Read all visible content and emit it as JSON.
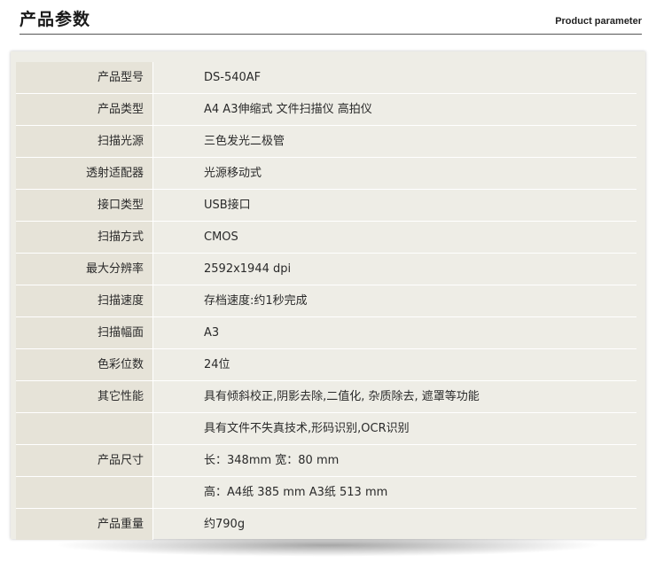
{
  "header": {
    "title": "产品参数",
    "subtitle": "Product parameter"
  },
  "specs": [
    {
      "label": "产品型号",
      "value": "DS-540AF"
    },
    {
      "label": "产品类型",
      "value": "A4 A3伸缩式 文件扫描仪 高拍仪"
    },
    {
      "label": "扫描光源",
      "value": "三色发光二极管"
    },
    {
      "label": "透射适配器",
      "value": "光源移动式"
    },
    {
      "label": "接口类型",
      "value": "USB接口"
    },
    {
      "label": "扫描方式",
      "value": "CMOS"
    },
    {
      "label": "最大分辨率",
      "value": "2592x1944 dpi"
    },
    {
      "label": "扫描速度",
      "value": "存档速度:约1秒完成"
    },
    {
      "label": "扫描幅面",
      "value": "A3"
    },
    {
      "label": "色彩位数",
      "value": "24位"
    },
    {
      "label": "其它性能",
      "value": "具有倾斜校正,阴影去除,二值化, 杂质除去, 遮罩等功能"
    },
    {
      "label": "",
      "value": "具有文件不失真技术,形码识别,OCR识别"
    },
    {
      "label": "产品尺寸",
      "value": "长：348mm 宽：80 mm"
    },
    {
      "label": "",
      "value": "高：A4纸 385 mm A3纸 513 mm"
    },
    {
      "label": "产品重量",
      "value": "约790g"
    }
  ]
}
